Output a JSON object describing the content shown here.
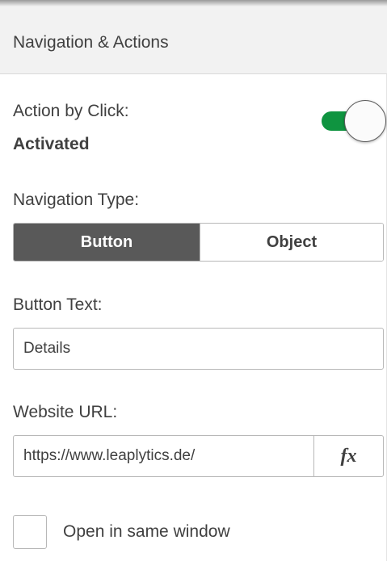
{
  "panel": {
    "title": "Navigation & Actions"
  },
  "action_by_click": {
    "label": "Action by Click:",
    "status": "Activated",
    "enabled": true
  },
  "navigation_type": {
    "label": "Navigation Type:",
    "options": [
      "Button",
      "Object"
    ],
    "selected": "Button"
  },
  "button_text": {
    "label": "Button Text:",
    "value": "Details"
  },
  "website_url": {
    "label": "Website URL:",
    "value": "https://www.leaplytics.de/",
    "expression_button": "fx"
  },
  "open_same_window": {
    "label": "Open in same window",
    "checked": false
  },
  "colors": {
    "toggle_on": "#0f9440",
    "segment_selected": "#595959",
    "text": "#404040"
  }
}
